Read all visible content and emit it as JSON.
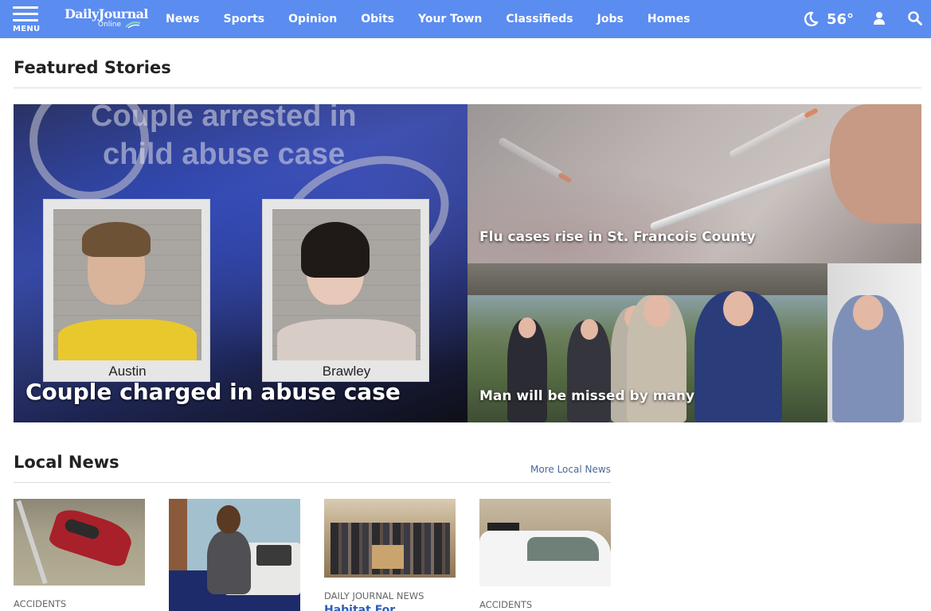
{
  "nav": {
    "menu_label": "MENU",
    "logo_main": "DailyJournal",
    "logo_sub": "Online",
    "links": [
      "News",
      "Sports",
      "Opinion",
      "Obits",
      "Your Town",
      "Classifieds",
      "Jobs",
      "Homes"
    ],
    "weather_temp": "56°",
    "weather_icon": "moon-icon",
    "user_icon": "user-icon",
    "search_icon": "search-icon",
    "bar_color": "#5b8cf0"
  },
  "featured": {
    "title": "Featured Stories",
    "stories": [
      {
        "caption": "Couple charged in abuse case",
        "image_text_top": "Couple arrested in",
        "image_text_bottom": "child abuse case",
        "mug_names": [
          "Austin",
          "Brawley"
        ]
      },
      {
        "caption": "Flu cases rise in St. Francois County"
      },
      {
        "caption": "Man will be missed by many"
      }
    ]
  },
  "local_news": {
    "title": "Local News",
    "more_link": "More Local News",
    "cards": [
      {
        "category": "ACCIDENTS",
        "title": ""
      },
      {
        "category": "",
        "title": ""
      },
      {
        "category": "DAILY JOURNAL NEWS",
        "title": "Habitat For"
      },
      {
        "category": "ACCIDENTS",
        "title": ""
      }
    ]
  }
}
